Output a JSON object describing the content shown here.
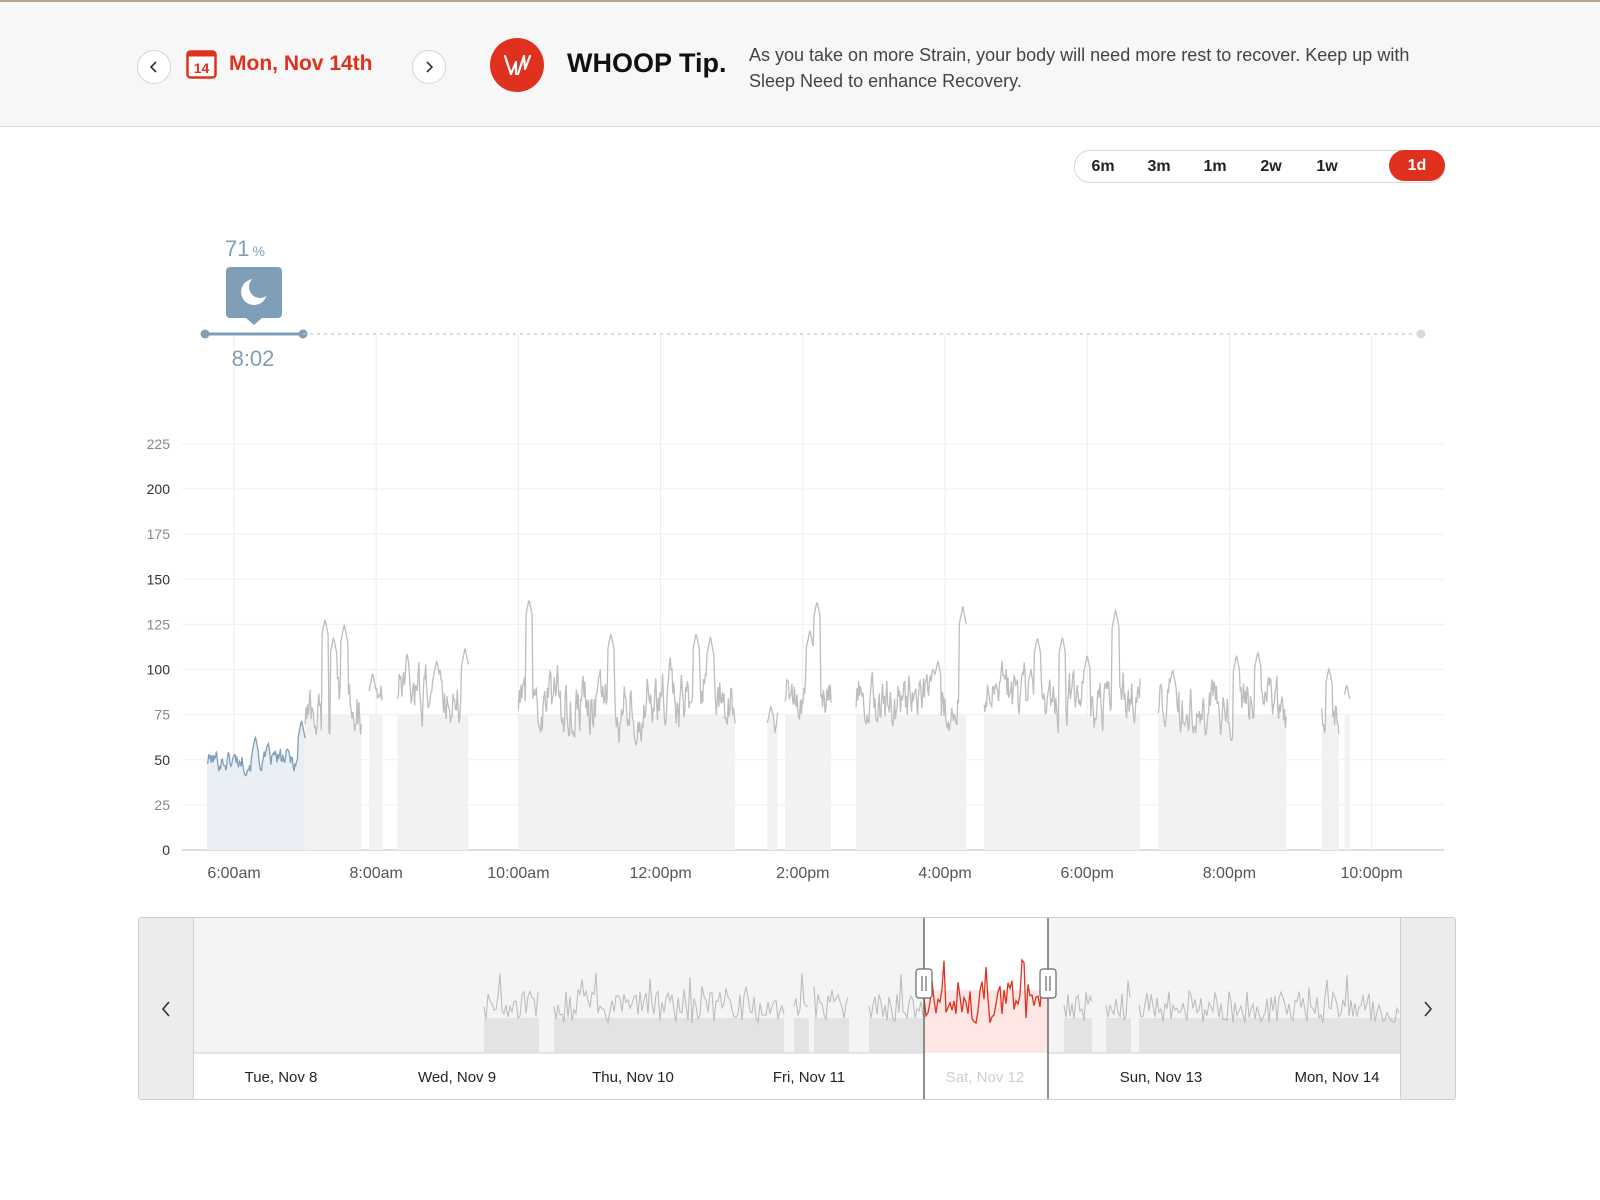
{
  "header": {
    "prev_day_icon": "chevron-left-icon",
    "calendar_icon": "calendar-icon",
    "calendar_day": "14",
    "date_label": "Mon, Nov 14th",
    "next_day_icon": "chevron-right-icon",
    "logo_icon": "whoop-logo-icon",
    "tip_title": "WHOOP Tip.",
    "tip_text": "As you take on more Strain, your body will need more rest to recover. Keep up with Sleep Need to enhance Recovery."
  },
  "range_selector": {
    "options": [
      "6m",
      "3m",
      "1m",
      "2w",
      "1w",
      "1d"
    ],
    "selected": "1d"
  },
  "sleep_marker": {
    "icon": "moon-icon",
    "percent_value": "71",
    "percent_unit": "%",
    "duration": "8:02"
  },
  "colors": {
    "accent": "#e0301e",
    "sleep": "#7f9fb8",
    "line": "#bdbdbd",
    "fill": "#f2f2f2"
  },
  "chart_data": {
    "type": "line",
    "ylim": [
      0,
      225
    ],
    "yticks": [
      0,
      25,
      50,
      75,
      100,
      125,
      150,
      175,
      200,
      225
    ],
    "x_tick_labels": [
      "6:00am",
      "8:00am",
      "10:00am",
      "12:00pm",
      "2:00pm",
      "4:00pm",
      "6:00pm",
      "8:00pm",
      "10:00pm"
    ],
    "x_range_hours": [
      5.6,
      23.0
    ],
    "grid": true,
    "sleep_span_hours": [
      5.6,
      7.0
    ],
    "segments": [
      {
        "kind": "sleep",
        "start_h": 5.62,
        "end_h": 7.0,
        "base": 50,
        "amp": 7,
        "peaks": [
          [
            6.3,
            63
          ],
          [
            6.95,
            72
          ]
        ]
      },
      {
        "kind": "active",
        "start_h": 7.0,
        "end_h": 7.8,
        "base": 75,
        "amp": 20,
        "peaks": [
          [
            7.28,
            128
          ],
          [
            7.55,
            125
          ],
          [
            7.4,
            118
          ]
        ]
      },
      {
        "kind": "active",
        "start_h": 7.9,
        "end_h": 8.1,
        "base": 85,
        "amp": 10,
        "peaks": [
          [
            7.95,
            98
          ]
        ]
      },
      {
        "kind": "active",
        "start_h": 8.3,
        "end_h": 9.3,
        "base": 88,
        "amp": 18,
        "peaks": [
          [
            8.85,
            105
          ],
          [
            9.25,
            112
          ]
        ]
      },
      {
        "kind": "active",
        "start_h": 10.0,
        "end_h": 13.05,
        "base": 82,
        "amp": 20,
        "peaks": [
          [
            10.15,
            139
          ],
          [
            11.3,
            120
          ],
          [
            12.5,
            120
          ],
          [
            12.7,
            118
          ]
        ]
      },
      {
        "kind": "active",
        "start_h": 13.5,
        "end_h": 13.65,
        "base": 72,
        "amp": 8,
        "peaks": [
          [
            13.55,
            80
          ]
        ]
      },
      {
        "kind": "active",
        "start_h": 13.75,
        "end_h": 14.4,
        "base": 85,
        "amp": 15,
        "peaks": [
          [
            14.2,
            138
          ],
          [
            14.1,
            122
          ]
        ]
      },
      {
        "kind": "active",
        "start_h": 14.75,
        "end_h": 16.3,
        "base": 82,
        "amp": 17,
        "peaks": [
          [
            15.9,
            105
          ],
          [
            16.25,
            135
          ]
        ]
      },
      {
        "kind": "active",
        "start_h": 16.55,
        "end_h": 18.75,
        "base": 83,
        "amp": 18,
        "peaks": [
          [
            17.3,
            118
          ],
          [
            17.65,
            118
          ],
          [
            18.4,
            133
          ],
          [
            18.0,
            108
          ]
        ]
      },
      {
        "kind": "active",
        "start_h": 19.0,
        "end_h": 20.8,
        "base": 78,
        "amp": 18,
        "peaks": [
          [
            20.1,
            108
          ],
          [
            20.4,
            110
          ],
          [
            19.2,
            100
          ]
        ]
      },
      {
        "kind": "active",
        "start_h": 21.3,
        "end_h": 21.55,
        "base": 80,
        "amp": 15,
        "peaks": [
          [
            21.4,
            101
          ]
        ]
      },
      {
        "kind": "active",
        "start_h": 21.62,
        "end_h": 21.7,
        "base": 75,
        "amp": 8,
        "peaks": [
          [
            21.65,
            92
          ]
        ]
      }
    ]
  },
  "navigator": {
    "prev_icon": "chevron-left-icon",
    "next_icon": "chevron-right-icon",
    "days": [
      "Tue, Nov 8",
      "Wed, Nov 9",
      "Thu, Nov 10",
      "Fri, Nov 11",
      "Sat, Nov 12",
      "Sun, Nov 13",
      "Mon, Nov 14"
    ],
    "selected_day": "Sat, Nov 12"
  }
}
